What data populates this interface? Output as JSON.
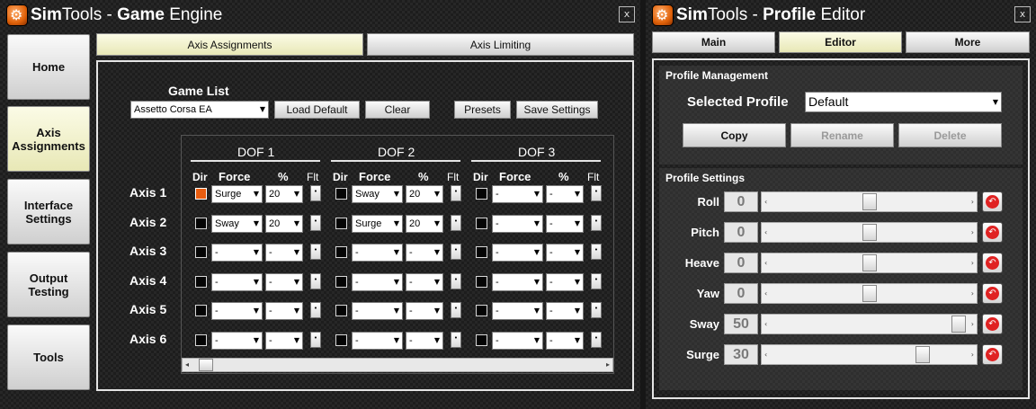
{
  "game_engine": {
    "title_bold": "Sim",
    "title_part": "Tools - ",
    "title_bold2": "Game",
    "title_part2": " Engine",
    "close": "x",
    "nav": [
      "Home",
      "Axis Assignments",
      "Interface Settings",
      "Output Testing",
      "Tools"
    ],
    "tabs": [
      "Axis Assignments",
      "Axis Limiting"
    ],
    "game_list_label": "Game List",
    "game_selected": "Assetto Corsa EA",
    "buttons": {
      "load_default": "Load Default",
      "clear": "Clear",
      "presets": "Presets",
      "save_settings": "Save Settings"
    },
    "dof_headers": [
      "DOF 1",
      "DOF 2",
      "DOF 3"
    ],
    "col_headers": {
      "dir": "Dir",
      "force": "Force",
      "pct": "%",
      "flt": "Flt"
    },
    "axes": [
      {
        "label": "Axis 1",
        "dofs": [
          {
            "dir": true,
            "force": "Surge",
            "pct": "20"
          },
          {
            "dir": false,
            "force": "Sway",
            "pct": "20"
          },
          {
            "dir": false,
            "force": "-",
            "pct": "-"
          }
        ]
      },
      {
        "label": "Axis 2",
        "dofs": [
          {
            "dir": false,
            "force": "Sway",
            "pct": "20"
          },
          {
            "dir": false,
            "force": "Surge",
            "pct": "20"
          },
          {
            "dir": false,
            "force": "-",
            "pct": "-"
          }
        ]
      },
      {
        "label": "Axis 3",
        "dofs": [
          {
            "dir": false,
            "force": "-",
            "pct": "-"
          },
          {
            "dir": false,
            "force": "-",
            "pct": "-"
          },
          {
            "dir": false,
            "force": "-",
            "pct": "-"
          }
        ]
      },
      {
        "label": "Axis 4",
        "dofs": [
          {
            "dir": false,
            "force": "-",
            "pct": "-"
          },
          {
            "dir": false,
            "force": "-",
            "pct": "-"
          },
          {
            "dir": false,
            "force": "-",
            "pct": "-"
          }
        ]
      },
      {
        "label": "Axis 5",
        "dofs": [
          {
            "dir": false,
            "force": "-",
            "pct": "-"
          },
          {
            "dir": false,
            "force": "-",
            "pct": "-"
          },
          {
            "dir": false,
            "force": "-",
            "pct": "-"
          }
        ]
      },
      {
        "label": "Axis 6",
        "dofs": [
          {
            "dir": false,
            "force": "-",
            "pct": "-"
          },
          {
            "dir": false,
            "force": "-",
            "pct": "-"
          },
          {
            "dir": false,
            "force": "-",
            "pct": "-"
          }
        ]
      }
    ],
    "flt_glyph": "•"
  },
  "profile_editor": {
    "title_bold": "Sim",
    "title_part": "Tools - ",
    "title_bold2": "Profile",
    "title_part2": " Editor",
    "close": "x",
    "tabs": [
      "Main",
      "Editor",
      "More"
    ],
    "management_title": "Profile Management",
    "selected_profile_label": "Selected Profile",
    "selected_profile": "Default",
    "buttons": {
      "copy": "Copy",
      "rename": "Rename",
      "delete": "Delete"
    },
    "settings_title": "Profile Settings",
    "sliders": [
      {
        "label": "Roll",
        "value": "0",
        "level": 0.5
      },
      {
        "label": "Pitch",
        "value": "0",
        "level": 0.5
      },
      {
        "label": "Heave",
        "value": "0",
        "level": 0.5
      },
      {
        "label": "Yaw",
        "value": "0",
        "level": 0.5
      },
      {
        "label": "Sway",
        "value": "50",
        "level": 1.0
      },
      {
        "label": "Surge",
        "value": "30",
        "level": 0.8
      }
    ],
    "colors": {
      "accent_orange": "#e85d10",
      "reset_red": "#e02222",
      "active_tab": "#f2f2c8"
    }
  }
}
